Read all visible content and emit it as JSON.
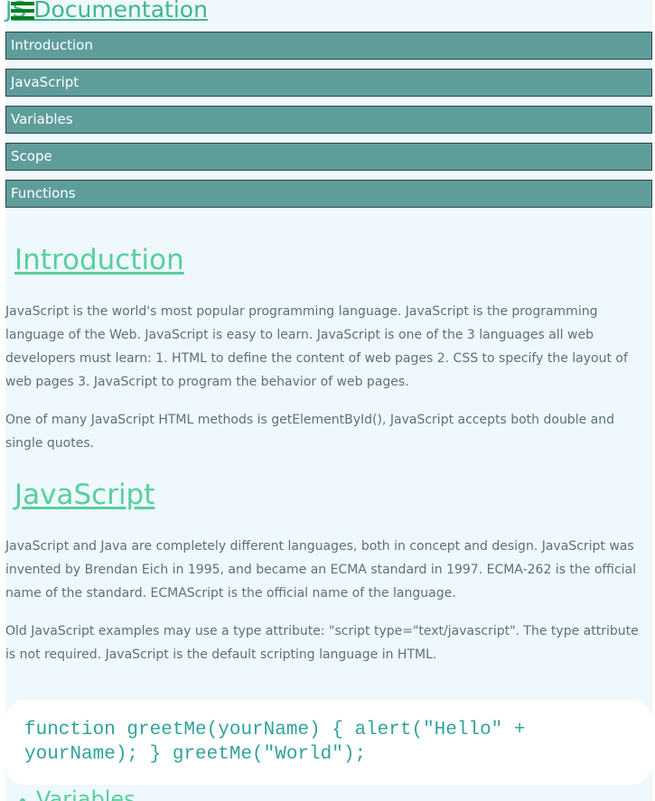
{
  "header": {
    "title": "JS Documentation",
    "menu_icon": "hamburger-menu-icon"
  },
  "nav": {
    "items": [
      {
        "label": "Introduction"
      },
      {
        "label": "JavaScript"
      },
      {
        "label": "Variables"
      },
      {
        "label": "Scope"
      },
      {
        "label": "Functions"
      }
    ]
  },
  "sections": {
    "introduction": {
      "heading": "Introduction",
      "paragraphs": [
        "JavaScript is the world's most popular programming language. JavaScript is the programming language of the Web. JavaScript is easy to learn. JavaScript is one of the 3 languages all web developers must learn: 1. HTML to define the content of web pages 2. CSS to specify the layout of web pages 3. JavaScript to program the behavior of web pages.",
        "One of many JavaScript HTML methods is getElementById(), JavaScript accepts both double and single quotes."
      ]
    },
    "javascript": {
      "heading": "JavaScript",
      "paragraphs": [
        "JavaScript and Java are completely different languages, both in concept and design. JavaScript was invented by Brendan Eich in 1995, and became an ECMA standard in 1997. ECMA-262 is the official name of the standard. ECMAScript is the official name of the language.",
        "Old JavaScript examples may use a type attribute: \"script type=\"text/javascript\". The type attribute is not required. JavaScript is the default scripting language in HTML."
      ],
      "code": "function greetMe(yourName) { alert(\"Hello\" + yourName); } greetMe(\"World\");"
    },
    "next_list": {
      "items": [
        "Variables"
      ]
    }
  },
  "colors": {
    "page_background": "#eff8fc",
    "nav_background": "#5f9d9b",
    "nav_border": "#2d4747",
    "heading": "#57cf9e",
    "body_text": "#5a7080",
    "code_text": "#2fa39a",
    "menu_icon": "#0d7d1f"
  }
}
